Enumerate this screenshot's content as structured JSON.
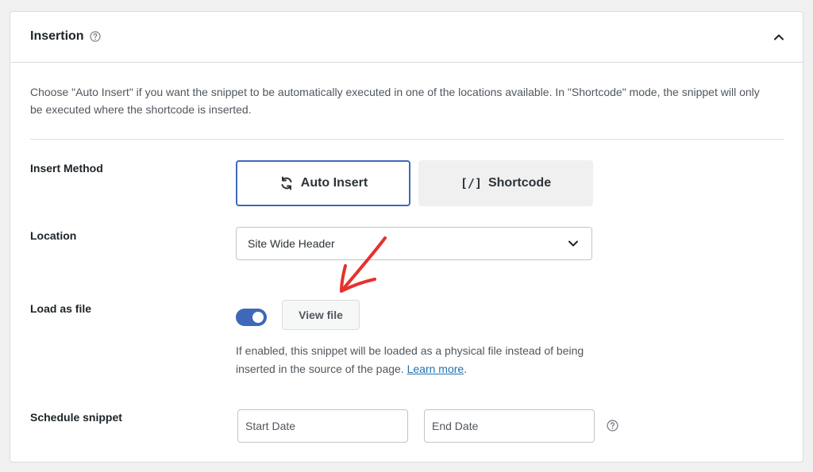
{
  "panel": {
    "title": "Insertion",
    "description": "Choose \"Auto Insert\" if you want the snippet to be automatically executed in one of the locations available. In \"Shortcode\" mode, the snippet will only be executed where the shortcode is inserted."
  },
  "insert_method": {
    "label": "Insert Method",
    "auto_insert_label": "Auto Insert",
    "shortcode_glyph": "[/]",
    "shortcode_label": "Shortcode",
    "selected": "Auto Insert"
  },
  "location": {
    "label": "Location",
    "selected_value": "Site Wide Header"
  },
  "load_as_file": {
    "label": "Load as file",
    "enabled": true,
    "view_file_label": "View file",
    "help_text": "If enabled, this snippet will be loaded as a physical file instead of being inserted in the source of the page.",
    "learn_more_label": "Learn more",
    "help_text_end": "."
  },
  "schedule": {
    "label": "Schedule snippet",
    "start_placeholder": "Start Date",
    "end_placeholder": "End Date"
  },
  "colors": {
    "accent": "#3e68b8",
    "link": "#2271b1",
    "annotation_arrow": "#e5322d"
  },
  "icons": {
    "help": "question-circle-icon",
    "collapse": "chevron-up-icon",
    "auto_insert": "sync-arrows-icon",
    "dropdown": "chevron-down-icon"
  }
}
